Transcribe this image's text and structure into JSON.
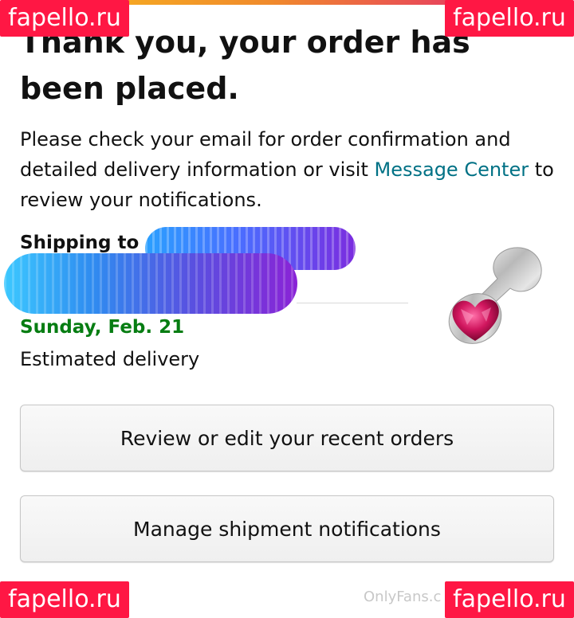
{
  "watermarks": {
    "site": "fapello.ru",
    "platform": "OnlyFans.c"
  },
  "confirmation": {
    "headline": "Thank you, your order has been placed.",
    "info_prefix": "Please check your email for order confirmation and detailed delivery information or visit ",
    "info_link": "Message Center",
    "info_suffix": " to review your notifications."
  },
  "shipping": {
    "label": "Shipping to"
  },
  "delivery": {
    "date": "Sunday, Feb. 21",
    "caption": "Estimated delivery"
  },
  "buttons": {
    "review_orders": "Review or edit your recent orders",
    "manage_notifications": "Manage shipment notifications"
  },
  "colors": {
    "link": "#007185",
    "delivery_date": "#067d12",
    "watermark": "#ff1744"
  },
  "icons": {
    "product": "product-thumbnail-image"
  }
}
